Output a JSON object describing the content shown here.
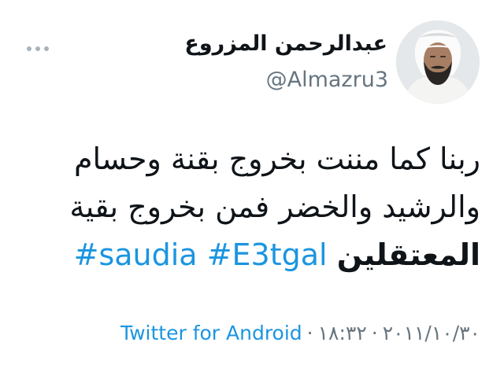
{
  "author": {
    "display_name": "عبدالرحمن المزروع",
    "handle": "@Almazru3",
    "avatar_icon": "user-photo-avatar"
  },
  "tweet": {
    "line1": "ربنا كما مننت بخروج بقنة وحسام",
    "line2": "والرشيد والخضر فمن بخروج بقية",
    "line3_word": "المعتقلين",
    "hashtags": [
      "#saudia",
      "#E3tgal"
    ]
  },
  "meta": {
    "date": "٢٠١١/١٠/٣٠",
    "time": "١٨:٣٢",
    "separator": "·",
    "source": "Twitter for Android"
  },
  "icons": {
    "more": "more-options-icon"
  },
  "colors": {
    "link": "#1b95e0",
    "secondary_text": "#66757f",
    "primary_text": "#0f1419",
    "more_dots": "#a8b3bd"
  }
}
